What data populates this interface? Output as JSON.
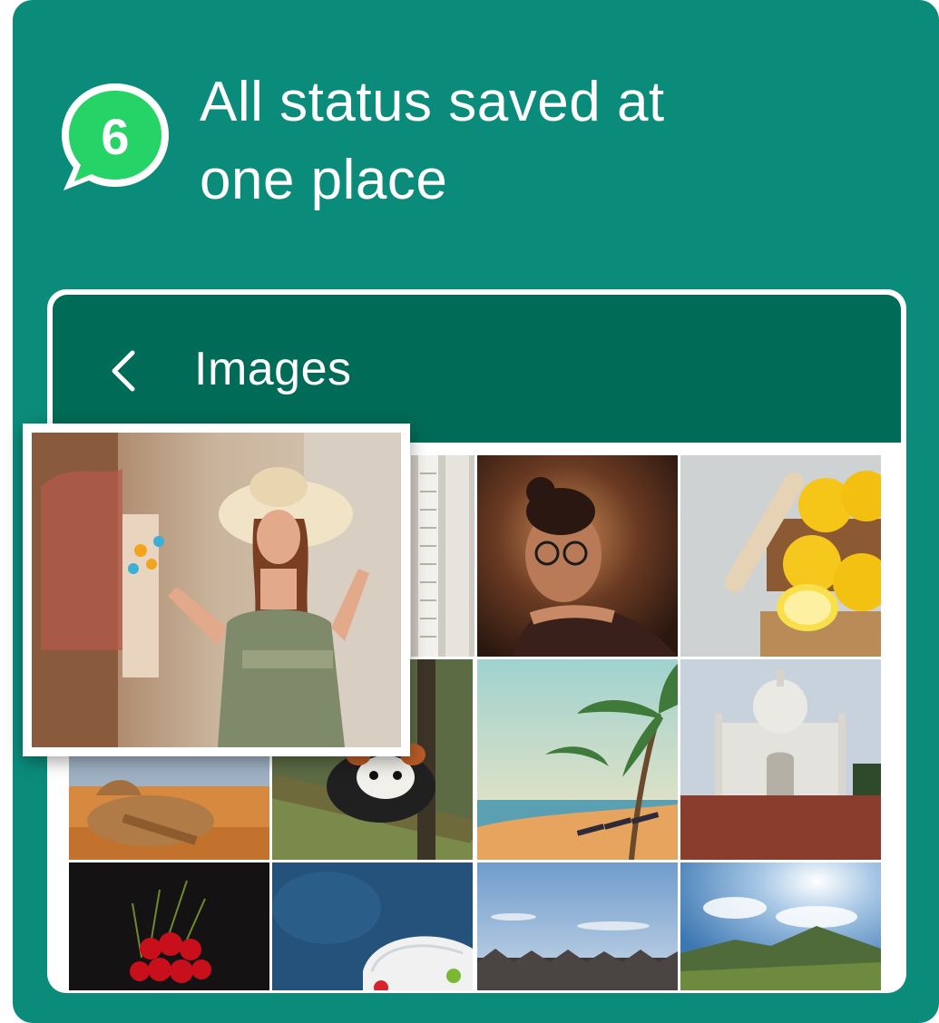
{
  "badge": {
    "number": "6",
    "icon": "whatsapp-bubble-icon",
    "color": "#25d366"
  },
  "headline": {
    "line1": "All status saved at",
    "line2": "one place"
  },
  "app": {
    "title": "Images",
    "back_icon": "chevron-left-icon"
  },
  "colors": {
    "card": "#0b8c7b",
    "appbar": "#006b56",
    "badge": "#25d366"
  },
  "gallery": {
    "images": [
      "woman-in-hat",
      "shutters",
      "woman-with-glasses",
      "lemons",
      "camel",
      "red-panda",
      "palm-beach",
      "taj-mahal",
      "cherries",
      "blue-basket",
      "seaside-houses",
      "mountain-sky"
    ]
  }
}
